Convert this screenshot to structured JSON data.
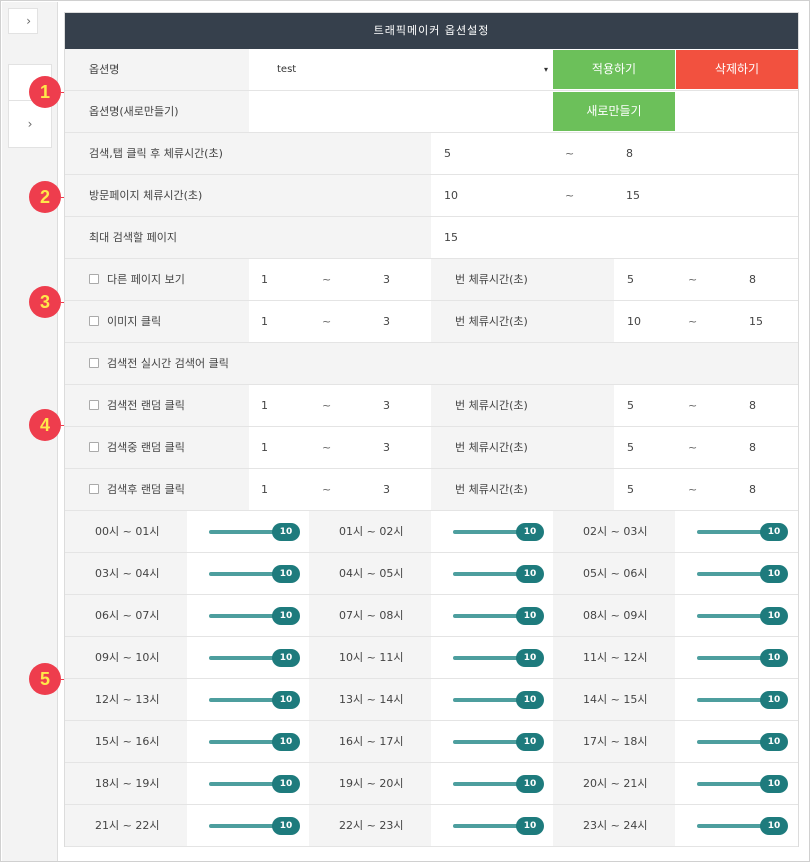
{
  "panel": {
    "title": "트래픽메이커 옵션설정"
  },
  "option_name": {
    "label": "옵션명",
    "selected": "test",
    "apply_label": "적용하기",
    "delete_label": "삭제하기"
  },
  "new_option": {
    "label": "옵션명(새로만들기)",
    "value": "",
    "create_label": "새로만들기"
  },
  "search_tab_stay": {
    "label": "검색,탭 클릭 후 체류시간(초)",
    "min": "5",
    "tilde": "~",
    "max": "8"
  },
  "visit_page_stay": {
    "label": "방문페이지 체류시간(초)",
    "min": "10",
    "tilde": "~",
    "max": "15"
  },
  "max_search_pages": {
    "label": "최대 검색할 페이지",
    "value": "15"
  },
  "click_rows": [
    {
      "label": "다른 페이지 보기",
      "count_min": "1",
      "tilde": "~",
      "count_max": "3",
      "stay_label": "번 체류시간(초)",
      "stay_min": "5",
      "stay_max": "8"
    },
    {
      "label": "이미지 클릭",
      "count_min": "1",
      "tilde": "~",
      "count_max": "3",
      "stay_label": "번 체류시간(초)",
      "stay_min": "10",
      "stay_max": "15"
    }
  ],
  "realtime_click": {
    "label": "검색전 실시간 검색어 클릭"
  },
  "random_rows": [
    {
      "label": "검색전 랜덤 클릭",
      "count_min": "1",
      "tilde": "~",
      "count_max": "3",
      "stay_label": "번 체류시간(초)",
      "stay_min": "5",
      "stay_max": "8"
    },
    {
      "label": "검색중 랜덤 클릭",
      "count_min": "1",
      "tilde": "~",
      "count_max": "3",
      "stay_label": "번 체류시간(초)",
      "stay_min": "5",
      "stay_max": "8"
    },
    {
      "label": "검색후 랜덤 클릭",
      "count_min": "1",
      "tilde": "~",
      "count_max": "3",
      "stay_label": "번 체류시간(초)",
      "stay_min": "5",
      "stay_max": "8"
    }
  ],
  "hours": [
    {
      "label": "00시 ~ 01시",
      "value": "10"
    },
    {
      "label": "01시 ~ 02시",
      "value": "10"
    },
    {
      "label": "02시 ~ 03시",
      "value": "10"
    },
    {
      "label": "03시 ~ 04시",
      "value": "10"
    },
    {
      "label": "04시 ~ 05시",
      "value": "10"
    },
    {
      "label": "05시 ~ 06시",
      "value": "10"
    },
    {
      "label": "06시 ~ 07시",
      "value": "10"
    },
    {
      "label": "07시 ~ 08시",
      "value": "10"
    },
    {
      "label": "08시 ~ 09시",
      "value": "10"
    },
    {
      "label": "09시 ~ 10시",
      "value": "10"
    },
    {
      "label": "10시 ~ 11시",
      "value": "10"
    },
    {
      "label": "11시 ~ 12시",
      "value": "10"
    },
    {
      "label": "12시 ~ 13시",
      "value": "10"
    },
    {
      "label": "13시 ~ 14시",
      "value": "10"
    },
    {
      "label": "14시 ~ 15시",
      "value": "10"
    },
    {
      "label": "15시 ~ 16시",
      "value": "10"
    },
    {
      "label": "16시 ~ 17시",
      "value": "10"
    },
    {
      "label": "17시 ~ 18시",
      "value": "10"
    },
    {
      "label": "18시 ~ 19시",
      "value": "10"
    },
    {
      "label": "19시 ~ 20시",
      "value": "10"
    },
    {
      "label": "20시 ~ 21시",
      "value": "10"
    },
    {
      "label": "21시 ~ 22시",
      "value": "10"
    },
    {
      "label": "22시 ~ 23시",
      "value": "10"
    },
    {
      "label": "23시 ~ 24시",
      "value": "10"
    }
  ],
  "markers": [
    "1",
    "2",
    "3",
    "4",
    "5"
  ],
  "icons": {
    "collapse": "chevron-right-icon",
    "select": "caret-down-icon",
    "chevron_glyph": "›",
    "caret_glyph": "▾"
  },
  "colors": {
    "header": "#36404c",
    "green": "#6cc05a",
    "red": "#f2513f",
    "slider": "#1e7b7d",
    "marker": "#ee3d4d"
  }
}
